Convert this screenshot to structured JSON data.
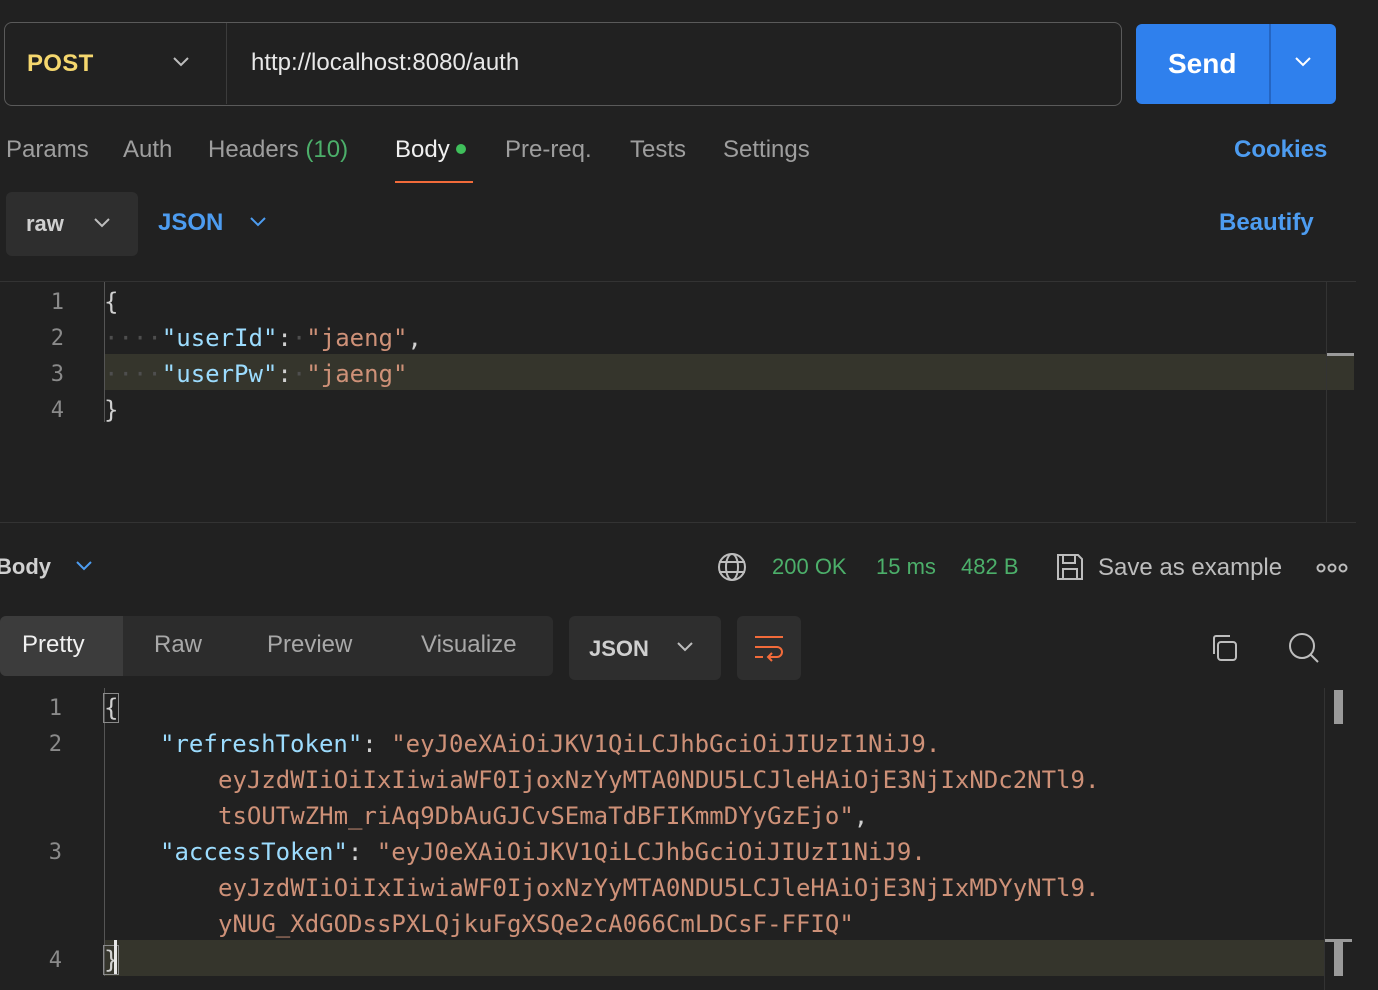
{
  "request": {
    "method": "POST",
    "url": "http://localhost:8080/auth",
    "send_label": "Send"
  },
  "tabs": {
    "params": "Params",
    "auth": "Auth",
    "headers": "Headers",
    "headers_count": "(10)",
    "body": "Body",
    "prereq": "Pre-req.",
    "tests": "Tests",
    "settings": "Settings",
    "cookies": "Cookies"
  },
  "body_controls": {
    "mode": "raw",
    "format": "JSON",
    "beautify": "Beautify"
  },
  "request_editor": {
    "line_numbers": [
      "1",
      "2",
      "3",
      "4"
    ],
    "open_brace": "{",
    "close_brace": "}",
    "lines": [
      {
        "key": "\"userId\"",
        "value": "\"jaeng\"",
        "trail": ","
      },
      {
        "key": "\"userPw\"",
        "value": "\"jaeng\"",
        "trail": ""
      }
    ]
  },
  "response": {
    "body_label": "Body",
    "status": "200 OK",
    "time": "15 ms",
    "size": "482 B",
    "save_example": "Save as example",
    "tabs": {
      "pretty": "Pretty",
      "raw": "Raw",
      "preview": "Preview",
      "visualize": "Visualize"
    },
    "format": "JSON"
  },
  "response_editor": {
    "line_numbers": [
      "1",
      "2",
      "3",
      "4"
    ],
    "open_brace": "{",
    "close_brace": "}",
    "refresh_key": "\"refreshToken\"",
    "refresh_parts": [
      "\"eyJ0eXAiOiJKV1QiLCJhbGciOiJIUzI1NiJ9.",
      "eyJzdWIiOiIxIiwiaWF0IjoxNzYyMTA0NDU5LCJleHAiOjE3NjIxNDc2NTl9.",
      "tsOUTwZHm_riAq9DbAuGJCvSEmaTdBFIKmmDYyGzEjo\""
    ],
    "access_key": "\"accessToken\"",
    "access_parts": [
      "\"eyJ0eXAiOiJKV1QiLCJhbGciOiJIUzI1NiJ9.",
      "eyJzdWIiOiIxIiwiaWF0IjoxNzYyMTA0NDU5LCJleHAiOjE3NjIxMDYyNTl9.",
      "yNUG_XdGODssPXLQjkuFgXSQe2cA066CmLDCsF-FFIQ\""
    ]
  }
}
